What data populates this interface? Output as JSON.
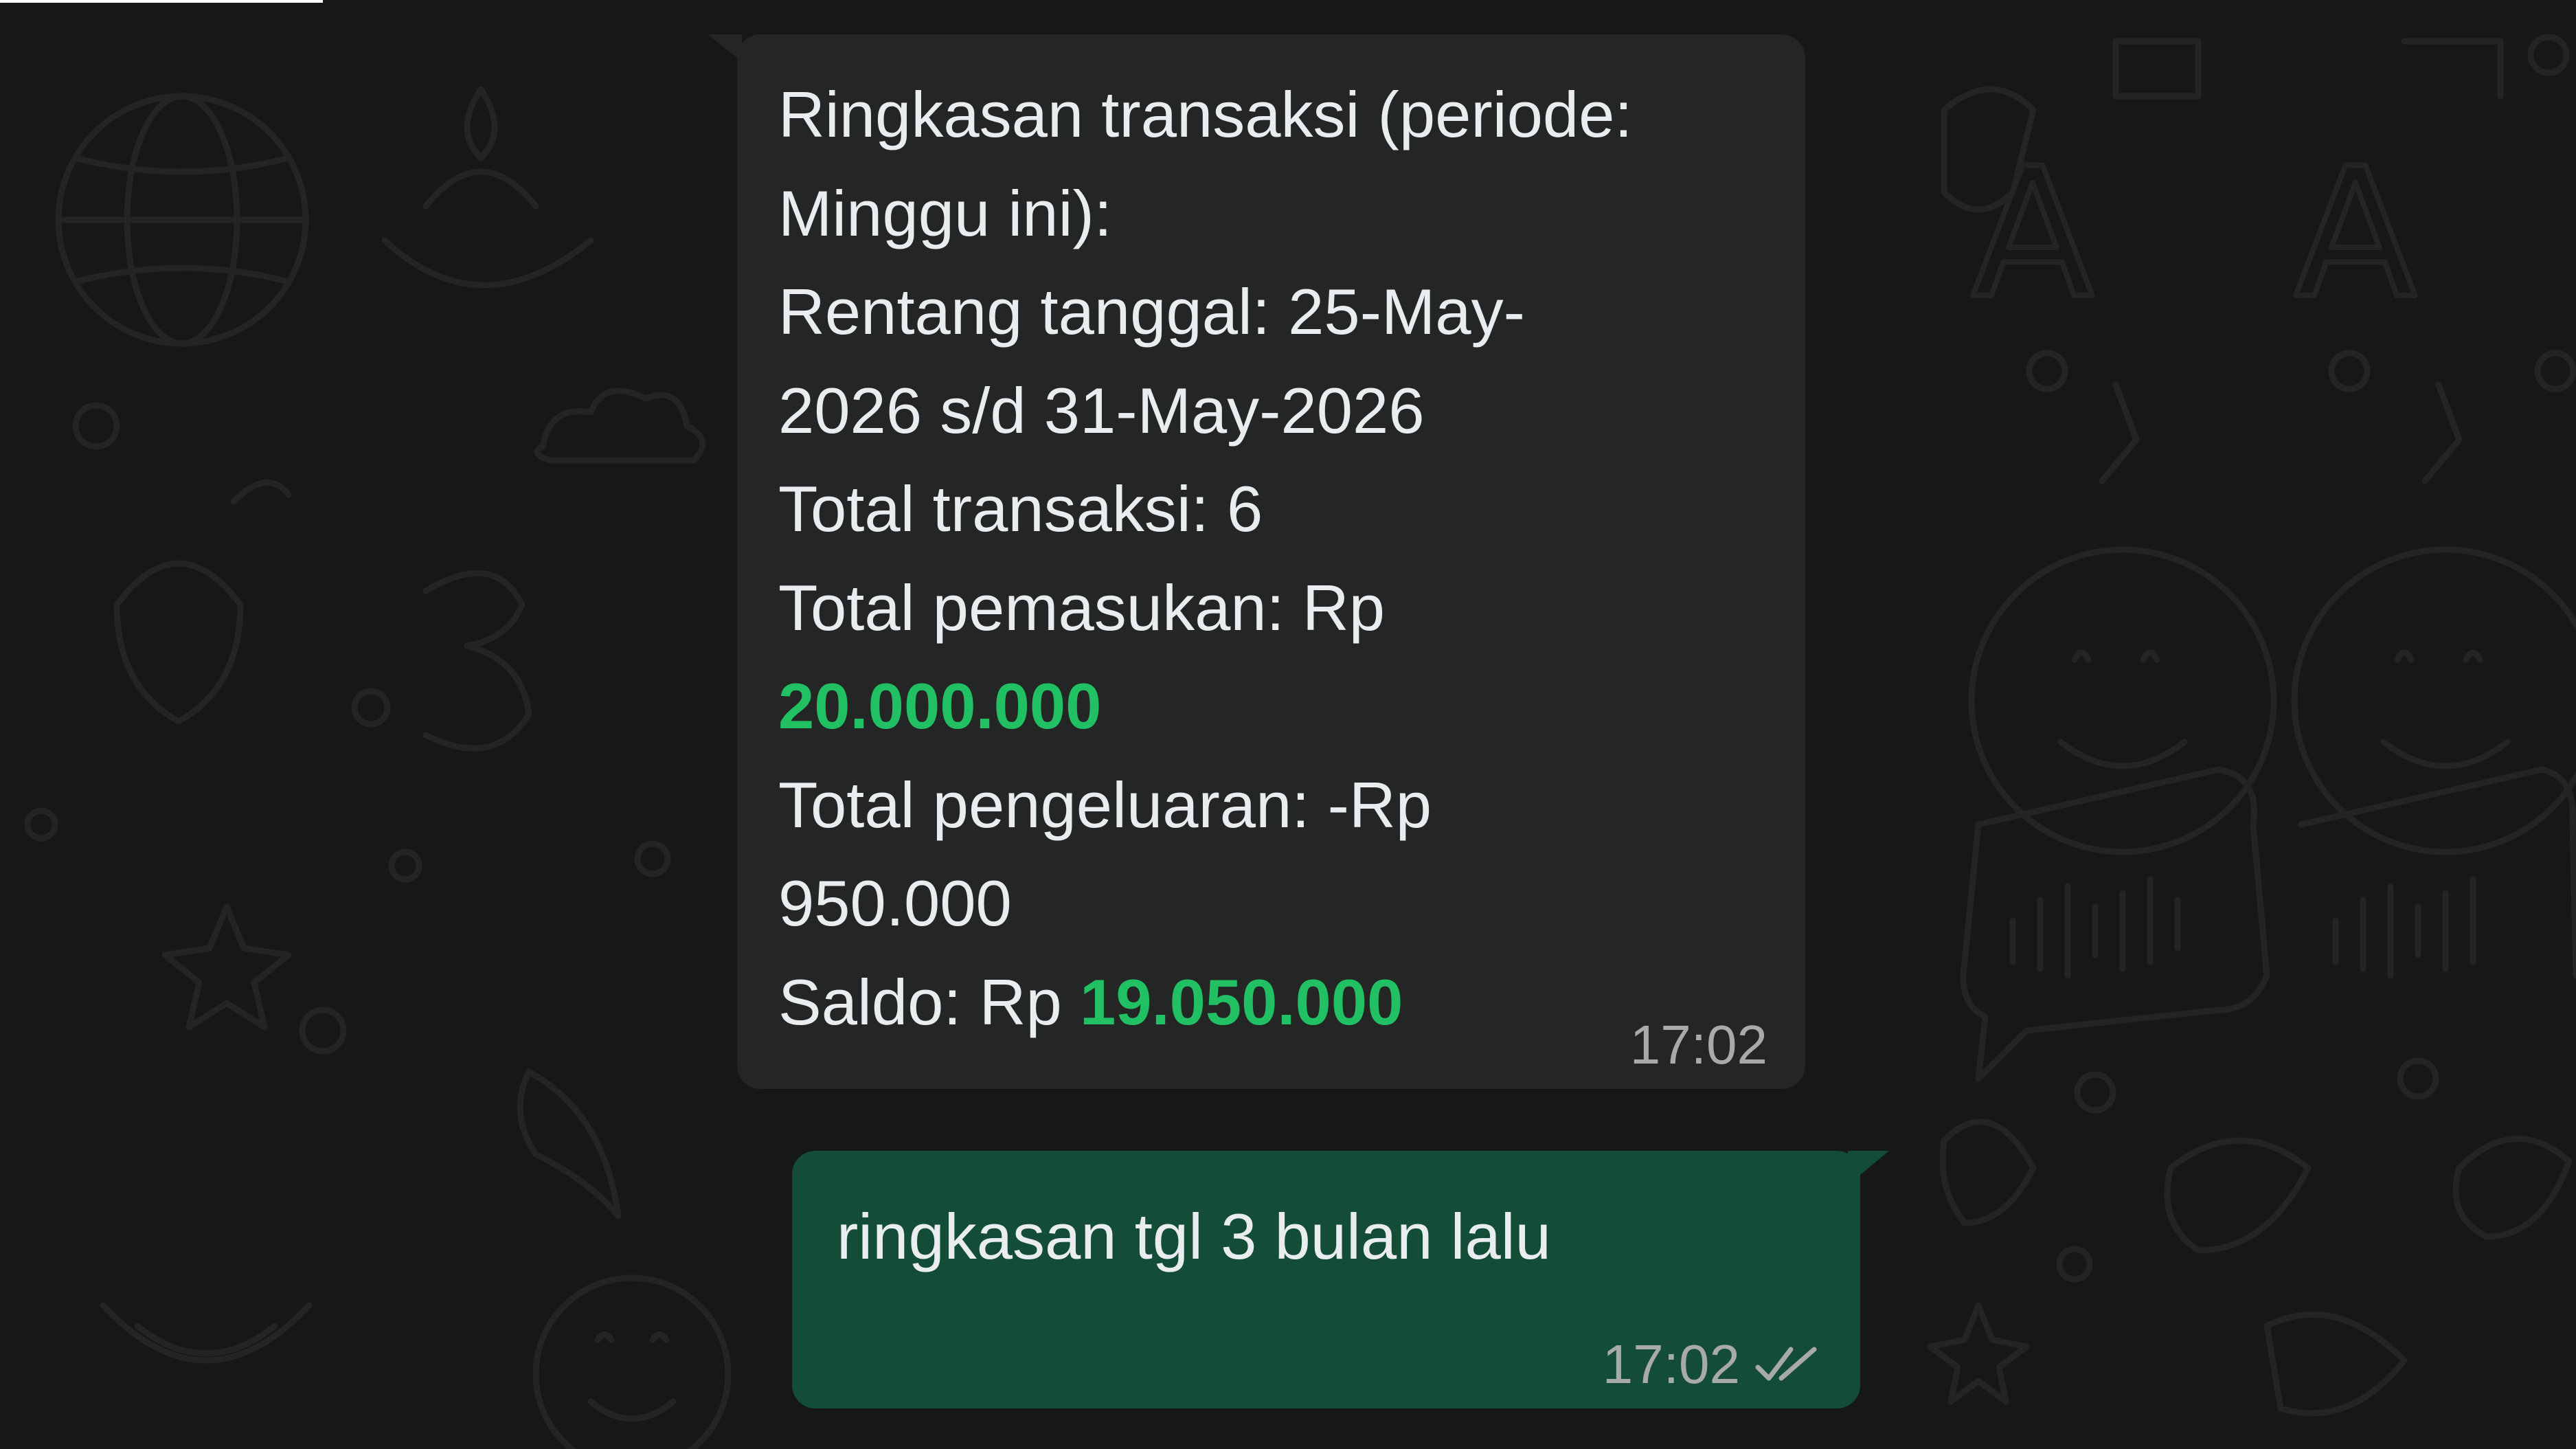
{
  "chat": {
    "incoming_message": {
      "line1": "Ringkasan transaksi (periode:",
      "line2": "Minggu ini):",
      "line3": "Rentang tanggal: 25-May-",
      "line4": "2026 s/d 31-May-2026",
      "line5": "Total transaksi: 6",
      "line6": "Total pemasukan: Rp",
      "income_value": "20.000.000",
      "line8": "Total pengeluaran: -Rp",
      "line9": "950.000",
      "saldo_label": "Saldo: Rp",
      "saldo_value": "19.050.000",
      "time": "17:02"
    },
    "outgoing_message": {
      "text": "ringkasan tgl 3 bulan lalu",
      "time": "17:02",
      "status_icon": "double-check-icon"
    }
  },
  "colors": {
    "background": "#161717",
    "incoming_bubble": "#242626",
    "outgoing_bubble": "#144d37",
    "highlight_green": "#21c063"
  }
}
